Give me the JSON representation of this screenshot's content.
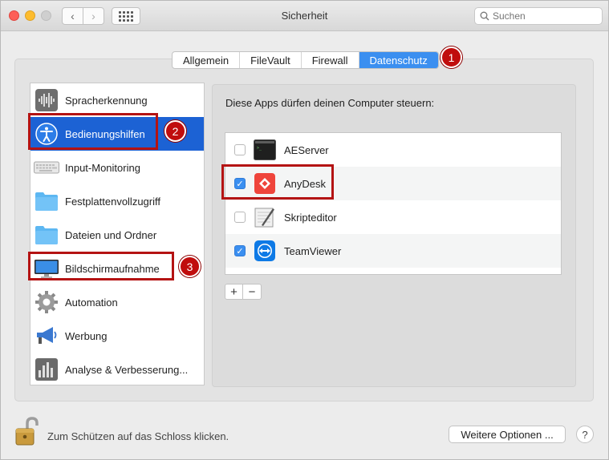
{
  "window": {
    "title": "Sicherheit"
  },
  "search": {
    "placeholder": "Suchen"
  },
  "tabs": [
    {
      "label": "Allgemein",
      "active": false
    },
    {
      "label": "FileVault",
      "active": false
    },
    {
      "label": "Firewall",
      "active": false
    },
    {
      "label": "Datenschutz",
      "active": true
    }
  ],
  "sidebar": {
    "items": [
      {
        "label": "Spracherkennung",
        "icon": "waveform-icon"
      },
      {
        "label": "Bedienungshilfen",
        "icon": "accessibility-icon",
        "selected": true
      },
      {
        "label": "Input-Monitoring",
        "icon": "keyboard-icon"
      },
      {
        "label": "Festplattenvollzugriff",
        "icon": "folder-icon"
      },
      {
        "label": "Dateien und Ordner",
        "icon": "folder-icon"
      },
      {
        "label": "Bildschirmaufnahme",
        "icon": "monitor-icon"
      },
      {
        "label": "Automation",
        "icon": "gear-icon"
      },
      {
        "label": "Werbung",
        "icon": "megaphone-icon"
      },
      {
        "label": "Analyse & Verbesserung...",
        "icon": "chart-icon"
      }
    ]
  },
  "panel": {
    "heading": "Diese Apps dürfen deinen Computer steuern:",
    "apps": [
      {
        "name": "AEServer",
        "checked": false,
        "icon": "terminal-icon"
      },
      {
        "name": "AnyDesk",
        "checked": true,
        "icon": "anydesk-icon"
      },
      {
        "name": "Skripteditor",
        "checked": false,
        "icon": "script-editor-icon"
      },
      {
        "name": "TeamViewer",
        "checked": true,
        "icon": "teamviewer-icon"
      }
    ],
    "add_label": "+",
    "remove_label": "−"
  },
  "annotations": {
    "badge1": "1",
    "badge2": "2",
    "badge3": "3"
  },
  "footer": {
    "lock_text": "Zum Schützen auf das Schloss klicken.",
    "options_button": "Weitere Optionen ...",
    "help_button": "?"
  },
  "colors": {
    "accent": "#3b8ff0",
    "selection": "#1c62d4",
    "annotation": "#b41313"
  }
}
